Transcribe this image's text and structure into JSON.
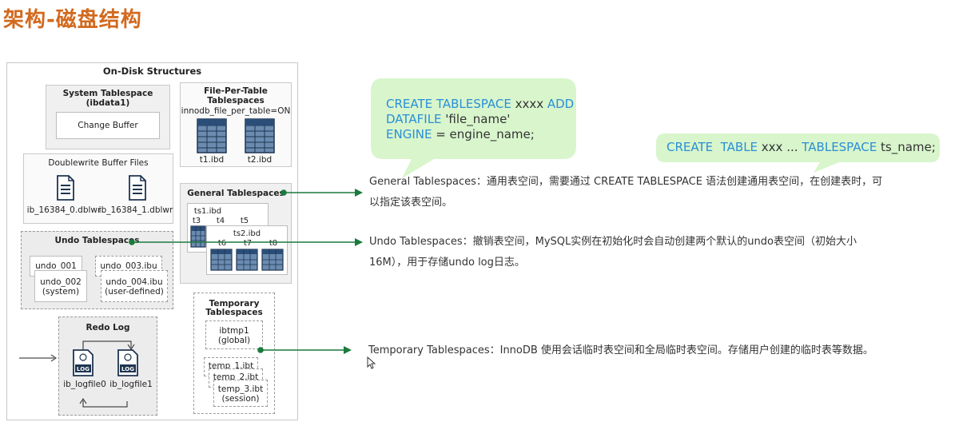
{
  "header": {
    "title": "架构-磁盘结构"
  },
  "diagram": {
    "panel_title": "On-Disk Structures",
    "system_tablespace": {
      "title": "System Tablespace",
      "subtitle": "(ibdata1)",
      "change_buffer": "Change Buffer"
    },
    "file_per_table": {
      "title": "File-Per-Table",
      "title2": "Tablespaces",
      "option": "innodb_file_per_table=ON",
      "file1": "t1.ibd",
      "file2": "t2.ibd"
    },
    "doublewrite": {
      "title": "Doublewrite Buffer Files",
      "file1": "ib_16384_0.dblwr",
      "file2": "ib_16384_1.dblwr"
    },
    "general": {
      "title": "General Tablespaces",
      "file1": "ts1.ibd",
      "file2": "ts2.ibd",
      "t3": "t3",
      "t4": "t4",
      "t5": "t5",
      "t6": "t6",
      "t7": "t7",
      "t8": "t8"
    },
    "undo": {
      "title": "Undo Tablespaces",
      "u1": "undo_001",
      "u2": "undo_002",
      "u2sub": "(system)",
      "u3": "undo_003.ibu",
      "u4": "undo_004.ibu",
      "u4sub": "(user-defined)"
    },
    "temporary": {
      "title": "Temporary",
      "title2": "Tablespaces",
      "ibtmp": "ibtmp1",
      "ibtmp_sub": "(global)",
      "t1": "temp_1.ibt",
      "t2": "temp_2.ibt",
      "t3": "temp_3.ibt",
      "t3sub": "(session)"
    },
    "redo": {
      "title": "Redo Log",
      "log_icon": "LOG",
      "file1": "ib_logfile0",
      "file2": "ib_logfile1"
    }
  },
  "code1": {
    "l1a": "CREATE TABLESPACE",
    "l1b": " xxxx ",
    "l1c": "ADD",
    "l2a": "DATAFILE",
    "l2b": " 'file_name'",
    "l3a": "ENGINE",
    "l3b": " = engine_name;"
  },
  "code2": {
    "a": "CREATE  TABLE",
    "b": " xxx ... ",
    "c": "TABLESPACE",
    "d": " ts_name;"
  },
  "descriptions": {
    "general_1": "General Tablespaces：通用表空间，需要通过 CREATE  TABLESPACE 语法创建通用表空间，在创建表时，可",
    "general_2": "以指定该表空间。",
    "undo_1": "Undo Tablespaces：撤销表空间，MySQL实例在初始化时会自动创建两个默认的undo表空间（初始大小",
    "undo_2": "16M），用于存储undo log日志。",
    "temp_1": "Temporary Tablespaces：InnoDB 使用会话临时表空间和全局临时表空间。存储用户创建的临时表等数据。"
  },
  "colors": {
    "title": "#d2691e",
    "arrow": "#1a7a3c",
    "bubble": "#d8f5cc",
    "code_blue": "#2a8fd6"
  }
}
